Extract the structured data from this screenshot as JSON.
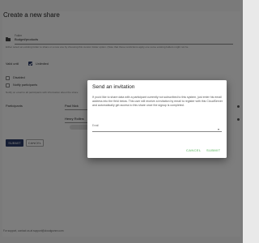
{
  "page": {
    "title": "Create a new share",
    "folder": {
      "label": "Folder",
      "value": "Budget/products",
      "help": "Either select an existing folder to share or a new one by choosing this custom folder option. (Note that these restrictions apply one some existing folders might not be"
    },
    "valid_until": {
      "label": "Valid until",
      "value": "Unlimited"
    },
    "options": [
      {
        "label": "Disabled"
      },
      {
        "label": "Notify participants"
      }
    ],
    "notify_help": "Notify on email to all participants with information about the share",
    "participants": {
      "label": "Participants",
      "items": [
        {
          "name": "Paul Nick"
        },
        {
          "name": "Henry Rollins"
        }
      ]
    },
    "buttons": {
      "submit": "SUBMIT",
      "cancel": "CANCEL"
    },
    "support": "For support, contact us at support@cloudgovsrv.com"
  },
  "dialog": {
    "title": "Send an invitation",
    "body": "If you'd like to share data with a participant currently not subscribed to this system, just enter his email address into the field below. This user will receive a invitation by email to register with this CloudServer and automatically get access to this share once the signup is completed.",
    "email_label": "Email",
    "email_value": "",
    "cancel": "CANCEL",
    "submit": "SUBMIT",
    "accent_color": "#4caf50"
  },
  "colors": {
    "primary": "#2b3a67",
    "backdrop": "rgba(0,0,0,0.5)"
  }
}
